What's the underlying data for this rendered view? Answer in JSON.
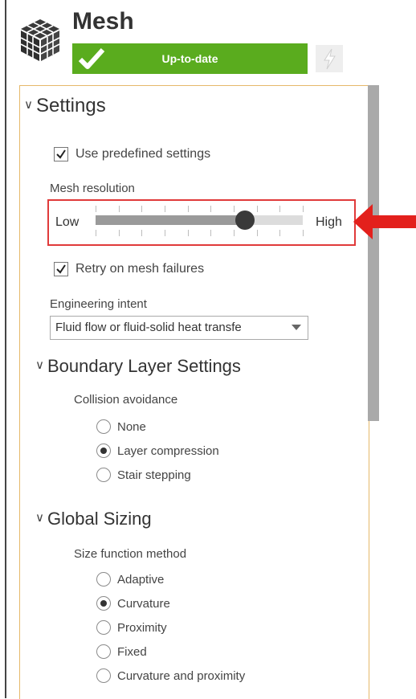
{
  "header": {
    "title": "Mesh",
    "status": "Up-to-date",
    "status_color": "#5aac1e"
  },
  "icons": {
    "mesh": "mesh-cube-icon",
    "status_check": "checkmark-icon",
    "update": "lightning-icon",
    "arrow": "red-arrow-icon"
  },
  "settings": {
    "heading": "Settings",
    "use_predefined": {
      "label": "Use predefined settings",
      "checked": true
    },
    "mesh_resolution": {
      "label": "Mesh resolution",
      "low_label": "Low",
      "high_label": "High",
      "value_fraction": 0.72,
      "highlight_color": "#e03a3a"
    },
    "retry": {
      "label": "Retry on mesh failures",
      "checked": true
    },
    "engineering_intent": {
      "label": "Engineering intent",
      "value": "Fluid flow or fluid-solid heat transfe"
    }
  },
  "boundary_layer": {
    "heading": "Boundary Layer Settings",
    "label": "Collision avoidance",
    "options": [
      "None",
      "Layer compression",
      "Stair stepping"
    ],
    "selected": 1
  },
  "global_sizing": {
    "heading": "Global Sizing",
    "label": "Size function method",
    "options": [
      "Adaptive",
      "Curvature",
      "Proximity",
      "Fixed",
      "Curvature and proximity"
    ],
    "selected": 1
  }
}
